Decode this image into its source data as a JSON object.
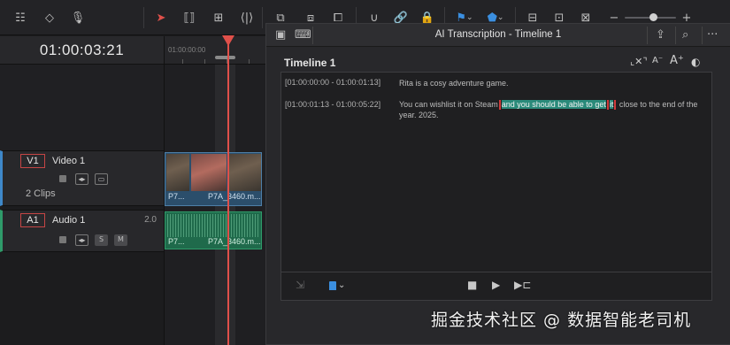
{
  "toolbar": {
    "icons": [
      "timeline-view-options-icon",
      "snapping-icon",
      "mic-icon",
      "selection-pointer-icon",
      "trim-edit-icon",
      "dynamic-trim-icon",
      "blade-icon",
      "insert-clip-icon",
      "overwrite-clip-icon",
      "replace-clip-icon",
      "snap-magnet-icon",
      "link-icon",
      "position-lock-icon",
      "flag-icon",
      "marker-icon",
      "zoom-full-icon",
      "zoom-detail-icon",
      "zoom-custom-icon",
      "zoom-out-icon",
      "zoom-in-icon"
    ],
    "zoom_level": 0.5
  },
  "timecode": "01:00:03:21",
  "ruler": {
    "label": "01:00:00:00"
  },
  "tracks": {
    "video": {
      "id": "V1",
      "name": "Video 1",
      "clip_count": "2 Clips",
      "clips": [
        "P7...",
        "P7A_3460.m..."
      ]
    },
    "audio": {
      "id": "A1",
      "name": "Audio 1",
      "volume": "2.0",
      "solo": "S",
      "mute": "M",
      "clips": [
        "P7...",
        "P7A_3460.m..."
      ]
    }
  },
  "panel": {
    "title": "AI Transcription - Timeline 1",
    "section_title": "Timeline 1",
    "segments": [
      {
        "time": "[01:00:00:00 - 01:00:01:13]",
        "text": "Rita is a cosy adventure game."
      },
      {
        "time": "[01:00:01:13 - 01:00:05:22]",
        "text_before": "You can wishlist it on Steam",
        "text_highlight": "and you should be able to get",
        "text_highlight2": "it",
        "text_after": "close to the end of the year. 2025."
      }
    ]
  },
  "watermark": "掘金技术社区 @ 数据智能老司机",
  "colors": {
    "playhead": "#e0504a",
    "video_track": "#3e88c9",
    "audio_track": "#2f9b6a",
    "highlight": "#2a8a7a"
  }
}
